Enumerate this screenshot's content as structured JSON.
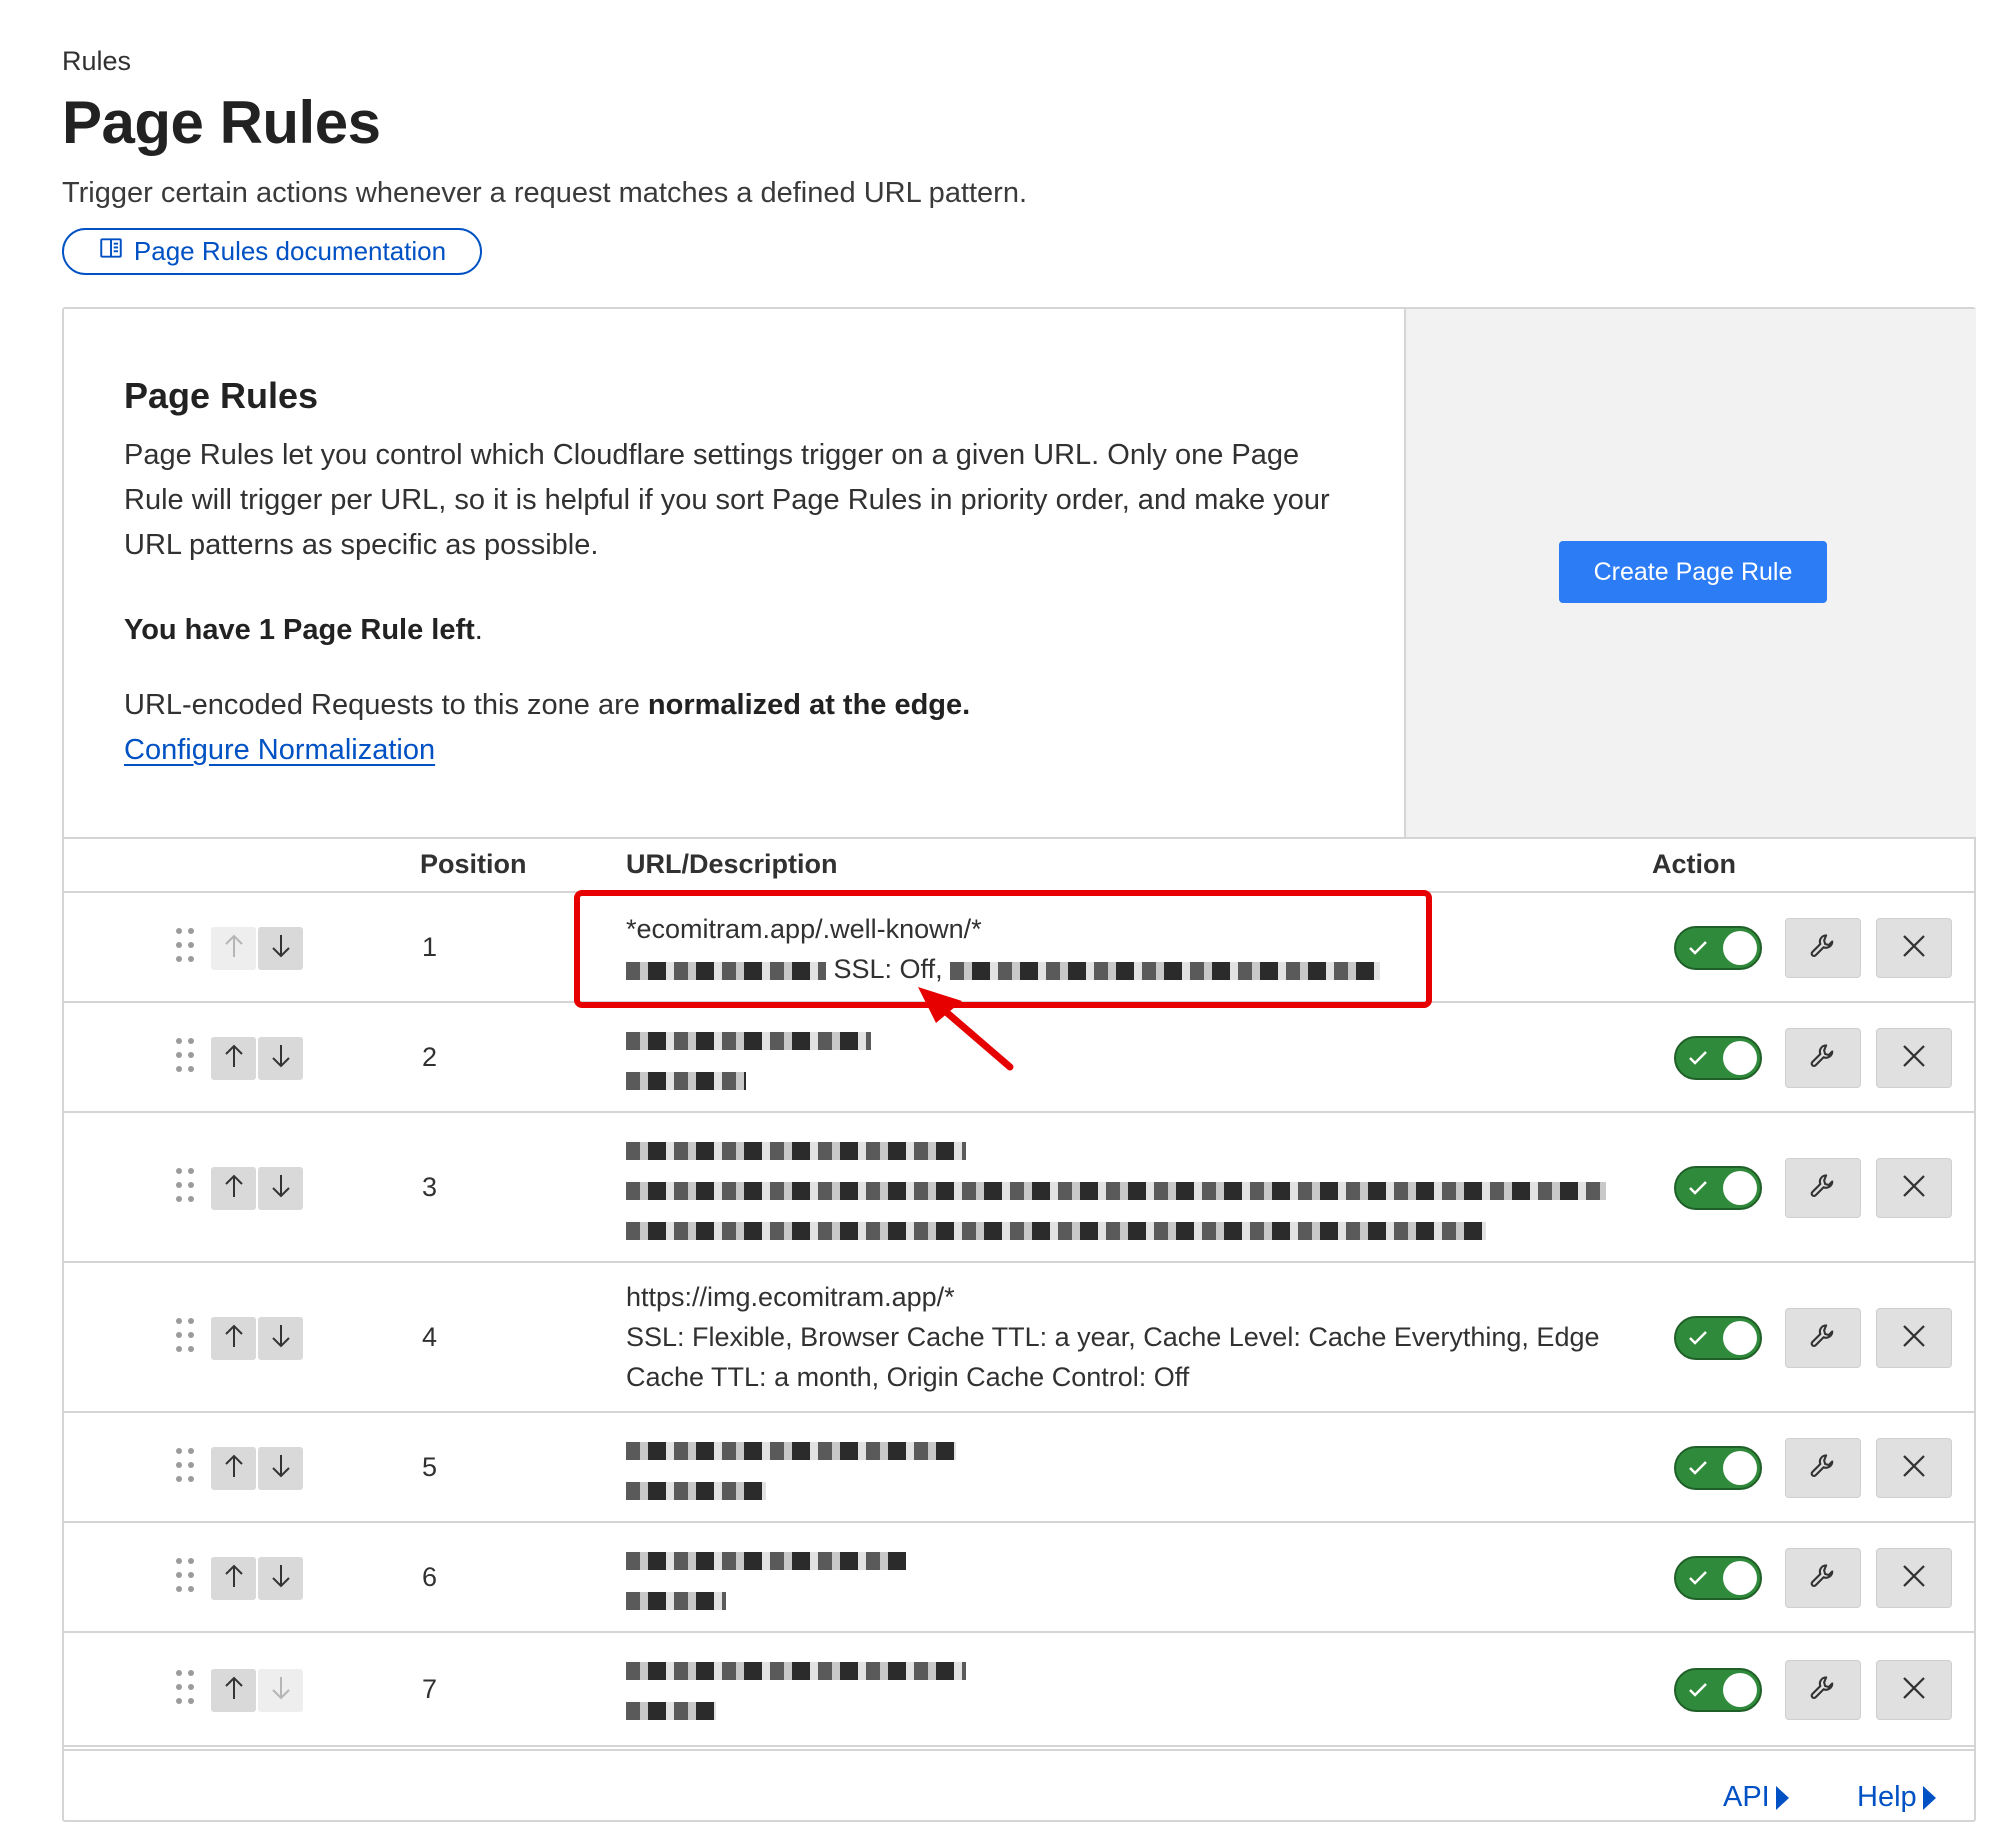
{
  "header": {
    "breadcrumb": "Rules",
    "title": "Page Rules",
    "description": "Trigger certain actions whenever a request matches a defined URL pattern.",
    "doc_link": "Page Rules documentation"
  },
  "info": {
    "title": "Page Rules",
    "body": "Page Rules let you control which Cloudflare settings trigger on a given URL. Only one Page Rule will trigger per URL, so it is helpful if you sort Page Rules in priority order, and make your URL patterns as specific as possible.",
    "rules_left_bold": "You have 1 Page Rule left",
    "rules_left_suffix": ".",
    "normalization_text": "URL-encoded Requests to this zone are ",
    "normalization_bold": "normalized at the edge.",
    "normalization_link": "Configure Normalization",
    "create_button": "Create Page Rule"
  },
  "table": {
    "headers": {
      "position": "Position",
      "url": "URL/Description",
      "action": "Action"
    },
    "rows": [
      {
        "position": "1",
        "url": "*ecomitram.app/.well-known/*",
        "desc": "SSL: Off,",
        "enabled": true,
        "up_disabled": true,
        "down_disabled": false
      },
      {
        "position": "2",
        "url": "",
        "desc": "",
        "enabled": true,
        "up_disabled": false,
        "down_disabled": false
      },
      {
        "position": "3",
        "url": "",
        "desc": "",
        "enabled": true,
        "up_disabled": false,
        "down_disabled": false
      },
      {
        "position": "4",
        "url": "https://img.ecomitram.app/*",
        "desc": "SSL: Flexible, Browser Cache TTL: a year, Cache Level: Cache Everything, Edge Cache TTL: a month, Origin Cache Control: Off",
        "enabled": true,
        "up_disabled": false,
        "down_disabled": false
      },
      {
        "position": "5",
        "url": "",
        "desc": "",
        "enabled": true,
        "up_disabled": false,
        "down_disabled": false
      },
      {
        "position": "6",
        "url": "",
        "desc": "",
        "enabled": true,
        "up_disabled": false,
        "down_disabled": false
      },
      {
        "position": "7",
        "url": "",
        "desc": "",
        "enabled": true,
        "up_disabled": false,
        "down_disabled": true
      }
    ]
  },
  "footer": {
    "api": "API",
    "help": "Help"
  },
  "colors": {
    "accent": "#0051c3",
    "primary_button": "#2c7cf6",
    "toggle_on": "#2f8a3b",
    "highlight": "#e60000"
  }
}
